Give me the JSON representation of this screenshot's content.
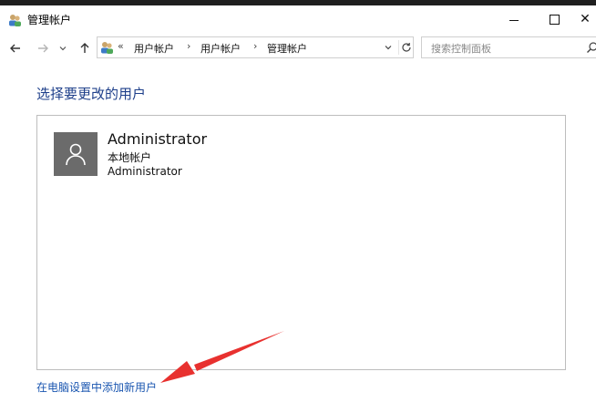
{
  "window": {
    "title": "管理帐户",
    "close_glyph": "✕"
  },
  "navigation": {
    "breadcrumb_lead": "«",
    "breadcrumbs": [
      "用户帐户",
      "用户帐户",
      "管理帐户"
    ],
    "breadcrumb_separator": "›"
  },
  "search": {
    "placeholder": "搜索控制面板"
  },
  "main": {
    "heading": "选择要更改的用户",
    "accounts": [
      {
        "name": "Administrator",
        "type": "本地帐户",
        "group": "Administrator"
      }
    ],
    "add_user_link": "在电脑设置中添加新用户"
  },
  "colors": {
    "heading": "#1e3f8a",
    "link": "#1a56b0",
    "annotation_arrow": "#e8312f",
    "avatar_bg": "#6b6b6b"
  },
  "icons": {
    "back": "arrow-left-icon",
    "forward": "arrow-right-icon",
    "recent": "chevron-down-icon",
    "up": "arrow-up-icon",
    "refresh": "refresh-icon",
    "search": "search-icon",
    "app": "users-icon",
    "avatar": "user-avatar-icon"
  }
}
